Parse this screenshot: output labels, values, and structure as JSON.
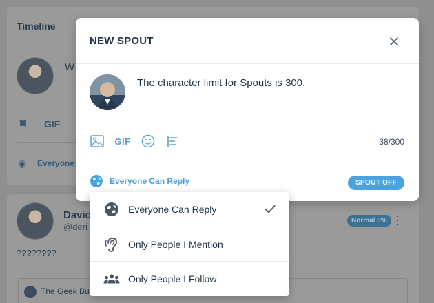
{
  "background": {
    "timeline_title": "Timeline",
    "composer_preview": "W",
    "gif_label": "GIF",
    "reply_preview": "Everyone",
    "post": {
      "name": "David",
      "handle": "@deri",
      "body": "????????",
      "badge": "Normal 0%",
      "embed_text": "The Geek Bu"
    }
  },
  "modal": {
    "title": "NEW SPOUT",
    "compose_text": "The character limit for Spouts is 300.",
    "toolbar": {
      "gif_label": "GIF"
    },
    "counter": "38/300",
    "reply_setting_label": "Everyone Can Reply",
    "spout_off_label": "SPOUT OFF"
  },
  "reply_menu": {
    "items": [
      {
        "label": "Everyone Can Reply",
        "icon": "globe-icon",
        "selected": true
      },
      {
        "label": "Only People I Mention",
        "icon": "ear-icon",
        "selected": false
      },
      {
        "label": "Only People I Follow",
        "icon": "group-icon",
        "selected": false
      }
    ]
  },
  "colors": {
    "accent": "#4aa3dc",
    "text_dark": "#1f3347",
    "overlay": "#8f8f8f"
  }
}
